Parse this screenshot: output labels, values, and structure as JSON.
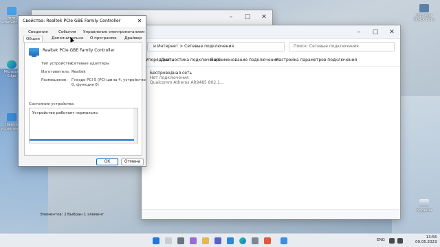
{
  "desktop": {
    "icons_right": [
      {
        "label": "Офлайн/Поиск Сеть"
      },
      {
        "label": "Корзина"
      }
    ],
    "icons_left": [
      {
        "label": "Этот компьютер"
      },
      {
        "label": "Microsoft Edge"
      },
      {
        "label": "Панель управления"
      }
    ]
  },
  "net_window": {
    "breadcrumb": "и Интернет  >  Сетевые подключения",
    "search_placeholder": "Поиск: Сетевые подключения",
    "toolbar": {
      "organize": "Упорядочить",
      "diagnose": "Диагностика подключения",
      "rename": "Переименование подключения",
      "settings": "Настройка параметров подключения"
    },
    "adapter": {
      "name": "Беспроводная сеть",
      "status": "Нет подключения",
      "device": "Qualcomm Atheros AR9485 802.1..."
    },
    "status": {
      "items": "Элементов: 2",
      "selected": "Выбран 1 элемент"
    }
  },
  "dialog": {
    "title": "Свойства: Realtek PCIe GBE Family Controller",
    "tabs_row1": [
      "Сведения",
      "События",
      "Управление электропитанием"
    ],
    "tabs_row2": [
      "Общие",
      "Дополнительно",
      "О программе",
      "Драйвер"
    ],
    "device_name": "Realtek PCIe GBE Family Controller",
    "props": {
      "type_label": "Тип устройства:",
      "type_value": "Сетевые адаптеры",
      "mfr_label": "Изготовитель:",
      "mfr_value": "Realtek",
      "loc_label": "Размещение:",
      "loc_value": "Гнездо PCI 5 (PCI-шина 4, устройство 0, функция 0)"
    },
    "status_group": "Состояние устройства",
    "status_text": "Устройство работает нормально.",
    "ok": "ОК",
    "cancel": "Отмена"
  },
  "taskbar": {
    "lang": "ENG",
    "time": "13:56",
    "date": "09.05.2023"
  }
}
